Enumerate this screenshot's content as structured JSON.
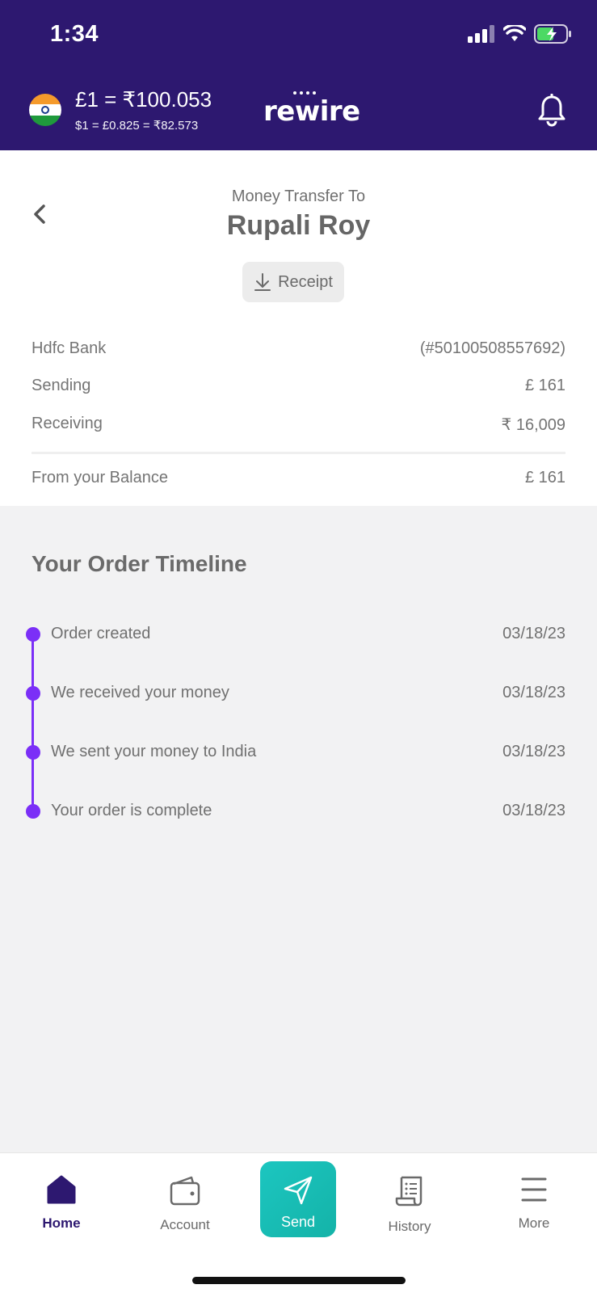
{
  "status_bar": {
    "time": "1:34"
  },
  "header": {
    "rate_main": "£1 = ₹100.053",
    "rate_sub": "$1 = £0.825 = ₹82.573",
    "logo": "rewire"
  },
  "transfer": {
    "label": "Money Transfer To",
    "recipient": "Rupali Roy",
    "receipt_label": "Receipt"
  },
  "details": [
    {
      "label": "Hdfc Bank",
      "value": "(#50100508557692)"
    },
    {
      "label": "Sending",
      "value": "£ 161"
    },
    {
      "label": "Receiving",
      "value": "₹ 16,009"
    }
  ],
  "balance": {
    "label": "From your Balance",
    "value": "£ 161"
  },
  "timeline": {
    "title": "Your Order Timeline",
    "items": [
      {
        "label": "Order created",
        "date": "03/18/23"
      },
      {
        "label": "We received your money",
        "date": "03/18/23"
      },
      {
        "label": "We sent your money to India",
        "date": "03/18/23"
      },
      {
        "label": "Your order is complete",
        "date": "03/18/23"
      }
    ]
  },
  "nav": {
    "home": "Home",
    "account": "Account",
    "send": "Send",
    "history": "History",
    "more": "More"
  },
  "colors": {
    "header_bg": "#2d1870",
    "timeline_accent": "#7b2ff7",
    "send_button": "#1cc6c0"
  },
  "icons": [
    "wifi-icon",
    "battery-charging-icon",
    "signal-icon",
    "india-flag-icon",
    "bell-icon",
    "back-chevron-icon",
    "download-icon",
    "home-icon",
    "wallet-icon",
    "paper-plane-icon",
    "receipt-list-icon",
    "menu-icon"
  ]
}
